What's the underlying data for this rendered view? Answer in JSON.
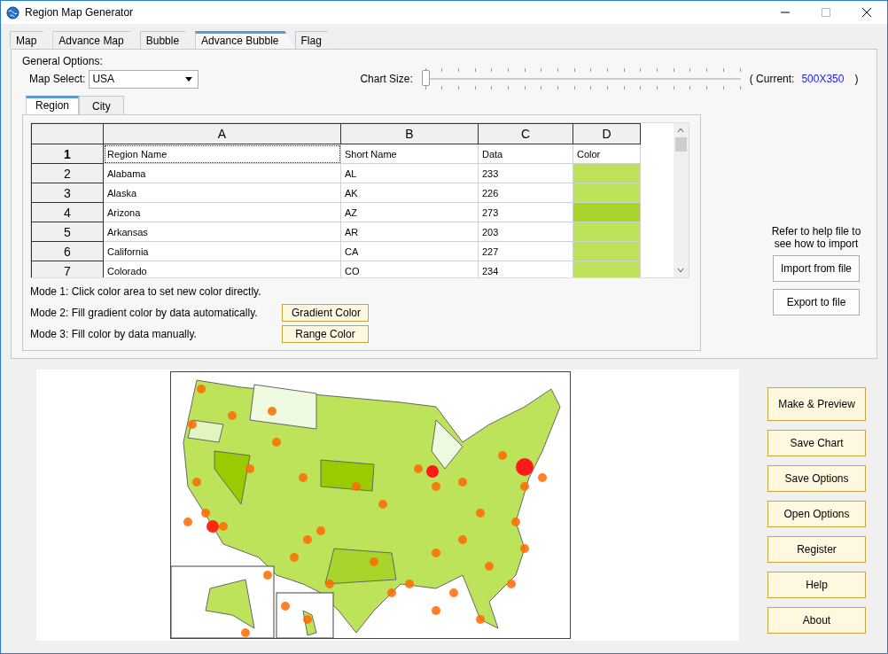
{
  "window": {
    "title": "Region Map Generator"
  },
  "tabs": [
    {
      "label": "Map",
      "selected": false
    },
    {
      "label": "Advance Map",
      "selected": false
    },
    {
      "label": "Bubble",
      "selected": false
    },
    {
      "label": "Advance Bubble",
      "selected": true
    },
    {
      "label": "Flag",
      "selected": false
    }
  ],
  "general_options": {
    "label": "General Options:",
    "map_select": {
      "label": "Map Select:",
      "value": "USA"
    },
    "chart_size": {
      "label": "Chart Size:",
      "level": 0,
      "current_label": "( Current:",
      "current_value": "500X350",
      "close_paren": ")"
    }
  },
  "sub_tabs": [
    {
      "label": "Region",
      "selected": true
    },
    {
      "label": "City",
      "selected": false
    }
  ],
  "table": {
    "columns": [
      "A",
      "B",
      "C",
      "D"
    ],
    "header_row": {
      "number": "1",
      "cells": [
        "Region Name",
        "Short Name",
        "Data",
        "Color"
      ]
    },
    "rows": [
      {
        "number": "2",
        "cells": [
          "Alabama",
          "AL",
          "233"
        ],
        "color": "#bde35b"
      },
      {
        "number": "3",
        "cells": [
          "Alaska",
          "AK",
          "226"
        ],
        "color": "#bde35b"
      },
      {
        "number": "4",
        "cells": [
          "Arizona",
          "AZ",
          "273"
        ],
        "color": "#a8d52b"
      },
      {
        "number": "5",
        "cells": [
          "Arkansas",
          "AR",
          "203"
        ],
        "color": "#bde35b"
      },
      {
        "number": "6",
        "cells": [
          "California",
          "CA",
          "227"
        ],
        "color": "#bde35b"
      },
      {
        "number": "7",
        "cells": [
          "Colorado",
          "CO",
          "234"
        ],
        "color": "#bde35b"
      }
    ]
  },
  "modes": [
    {
      "text": "Mode 1: Click color area to set new color directly."
    },
    {
      "text": "Mode 2: Fill gradient color by data automatically.",
      "button": "Gradient Color"
    },
    {
      "text": "Mode 3: Fill color by data manually.",
      "button": "Range Color"
    }
  ],
  "import_hint": "Refer to help file to see how to import",
  "import_buttons": [
    "Import from file",
    "Export to file"
  ],
  "side_buttons": [
    "Make & Preview",
    "Save Chart",
    "Save Options",
    "Open Options",
    "Register",
    "Help",
    "About"
  ]
}
